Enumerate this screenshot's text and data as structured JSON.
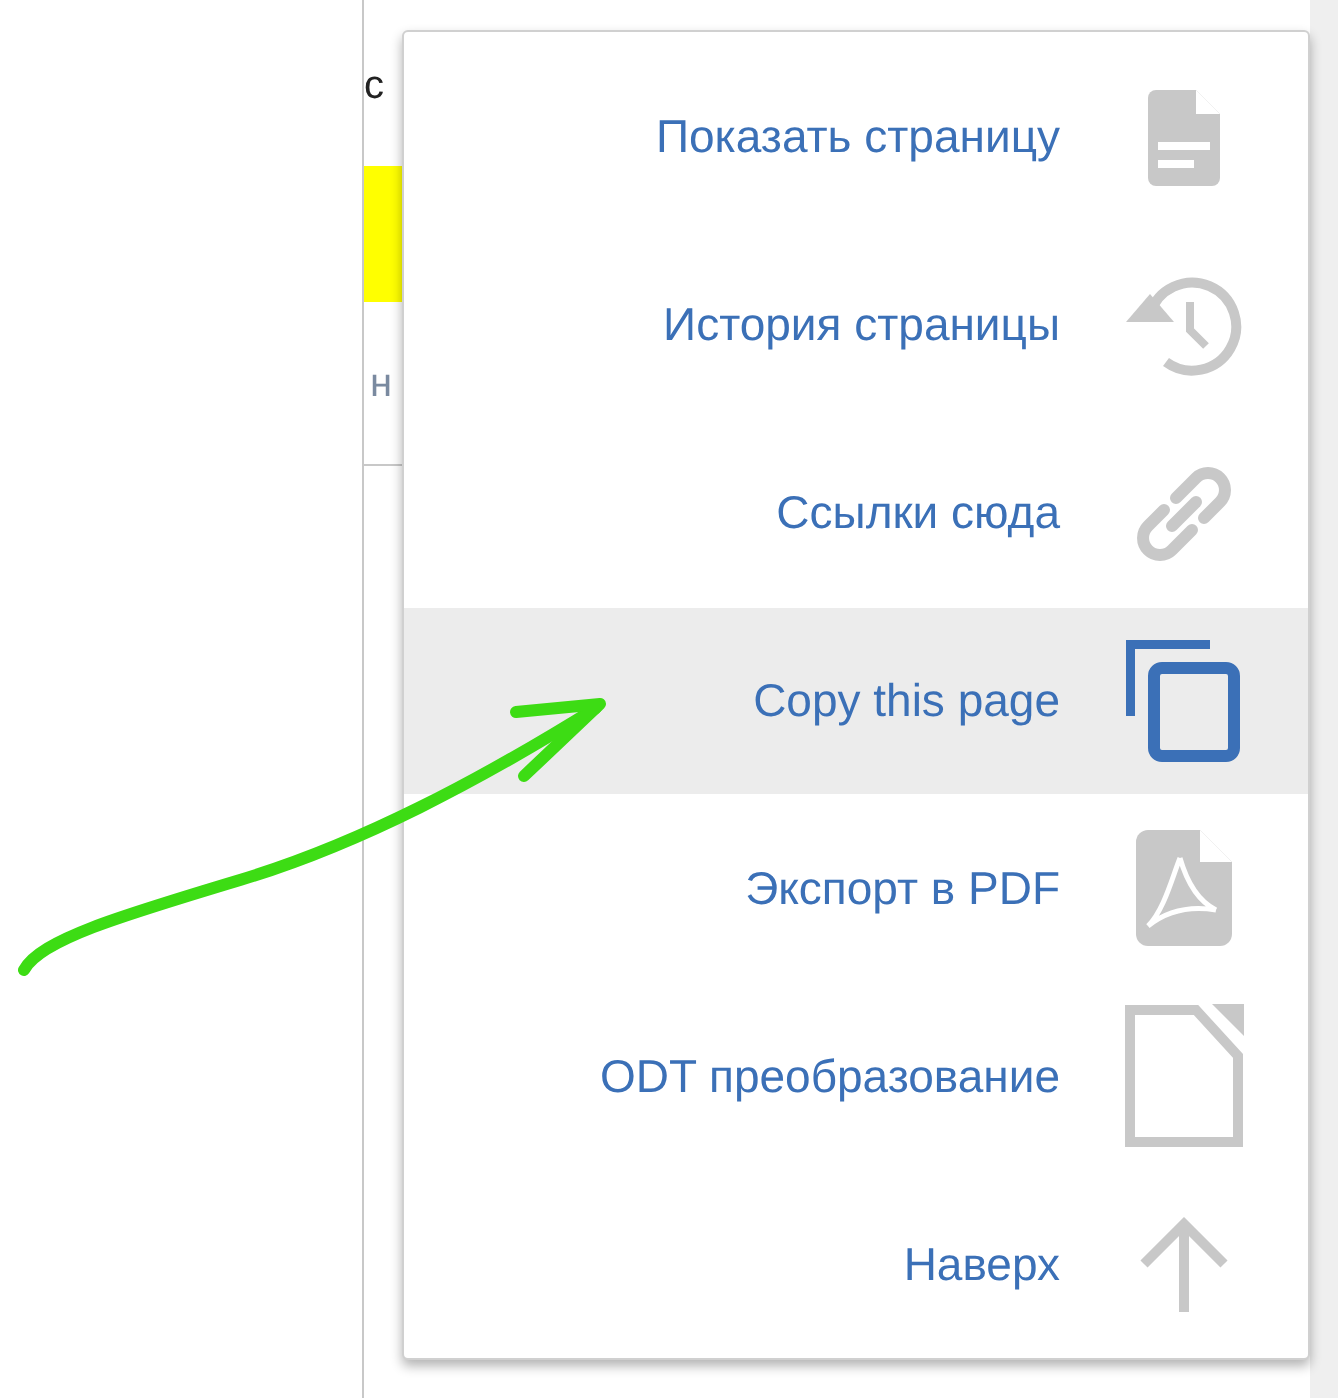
{
  "page_fragments": [
    {
      "kind": "text",
      "text": "c"
    },
    {
      "kind": "highlight"
    },
    {
      "kind": "text",
      "text": "н"
    }
  ],
  "menu": {
    "items": [
      {
        "label": "Показать страницу",
        "selected": false
      },
      {
        "label": "История страницы",
        "selected": false
      },
      {
        "label": "Ссылки сюда",
        "selected": false
      },
      {
        "label": "Copy this page",
        "selected": true
      },
      {
        "label": "Экспорт в PDF",
        "selected": false
      },
      {
        "label": "ODT преобразование",
        "selected": false
      },
      {
        "label": "Наверх",
        "selected": false
      }
    ]
  }
}
